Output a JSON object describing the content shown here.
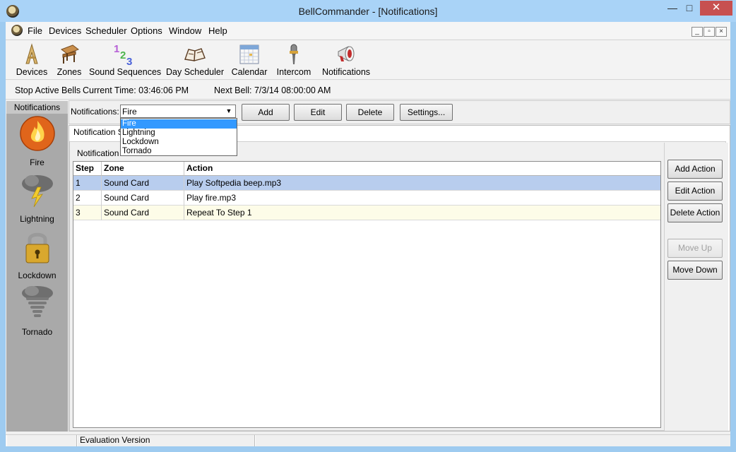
{
  "window": {
    "title": "BellCommander - [Notifications]",
    "caption_buttons": {
      "minimize": "—",
      "maximize": "□",
      "close": "✕"
    }
  },
  "menu": {
    "items": [
      "File",
      "Devices",
      "Scheduler",
      "Options",
      "Window",
      "Help"
    ],
    "mdi_buttons": [
      "_",
      "▫",
      "×"
    ]
  },
  "toolbar": {
    "buttons": [
      {
        "label": "Devices",
        "icon": "devices-icon"
      },
      {
        "label": "Zones",
        "icon": "zones-icon"
      },
      {
        "label": "Sound Sequences",
        "icon": "sound-sequences-icon"
      },
      {
        "label": "Day Scheduler",
        "icon": "day-scheduler-icon"
      },
      {
        "label": "Calendar",
        "icon": "calendar-icon"
      },
      {
        "label": "Intercom",
        "icon": "intercom-icon"
      },
      {
        "label": "Notifications",
        "icon": "notifications-icon"
      }
    ]
  },
  "status_row": {
    "stop_bells": "Stop Active Bells",
    "current_time": "Current Time: 03:46:06 PM",
    "next_bell": "Next Bell: 7/3/14 08:00:00 AM"
  },
  "side_panel": {
    "header": "Notifications",
    "items": [
      {
        "label": "Fire",
        "icon": "fire-icon"
      },
      {
        "label": "Lightning",
        "icon": "lightning-icon"
      },
      {
        "label": "Lockdown",
        "icon": "lock-icon"
      },
      {
        "label": "Tornado",
        "icon": "tornado-icon"
      }
    ]
  },
  "notification_bar": {
    "label": "Notifications:",
    "selected": "Fire",
    "options": [
      "Fire",
      "Lightning",
      "Lockdown",
      "Tornado"
    ],
    "buttons": {
      "add": "Add",
      "edit": "Edit",
      "delete": "Delete",
      "settings": "Settings..."
    }
  },
  "tabs": {
    "outer": "Notification S",
    "inner": "Notification S"
  },
  "grid": {
    "columns": [
      "Step",
      "Zone",
      "Action"
    ],
    "rows": [
      [
        "1",
        "Sound Card",
        "Play Softpedia beep.mp3"
      ],
      [
        "2",
        "Sound Card",
        "Play fire.mp3"
      ],
      [
        "3",
        "Sound Card",
        "Repeat To Step 1"
      ]
    ]
  },
  "actions": {
    "add_action": "Add Action",
    "edit_action": "Edit Action",
    "delete_action": "Delete Action",
    "move_up": "Move Up",
    "move_down": "Move Down"
  },
  "statusbar": {
    "text": "Evaluation Version"
  },
  "colors": {
    "titlebar": "#a9d3f7",
    "close_button": "#c75050",
    "selected_row": "#b8cdee",
    "highlight_row": "#fdfce8",
    "dropdown_selection": "#3399ff",
    "side_panel": "#a9a9a9"
  }
}
